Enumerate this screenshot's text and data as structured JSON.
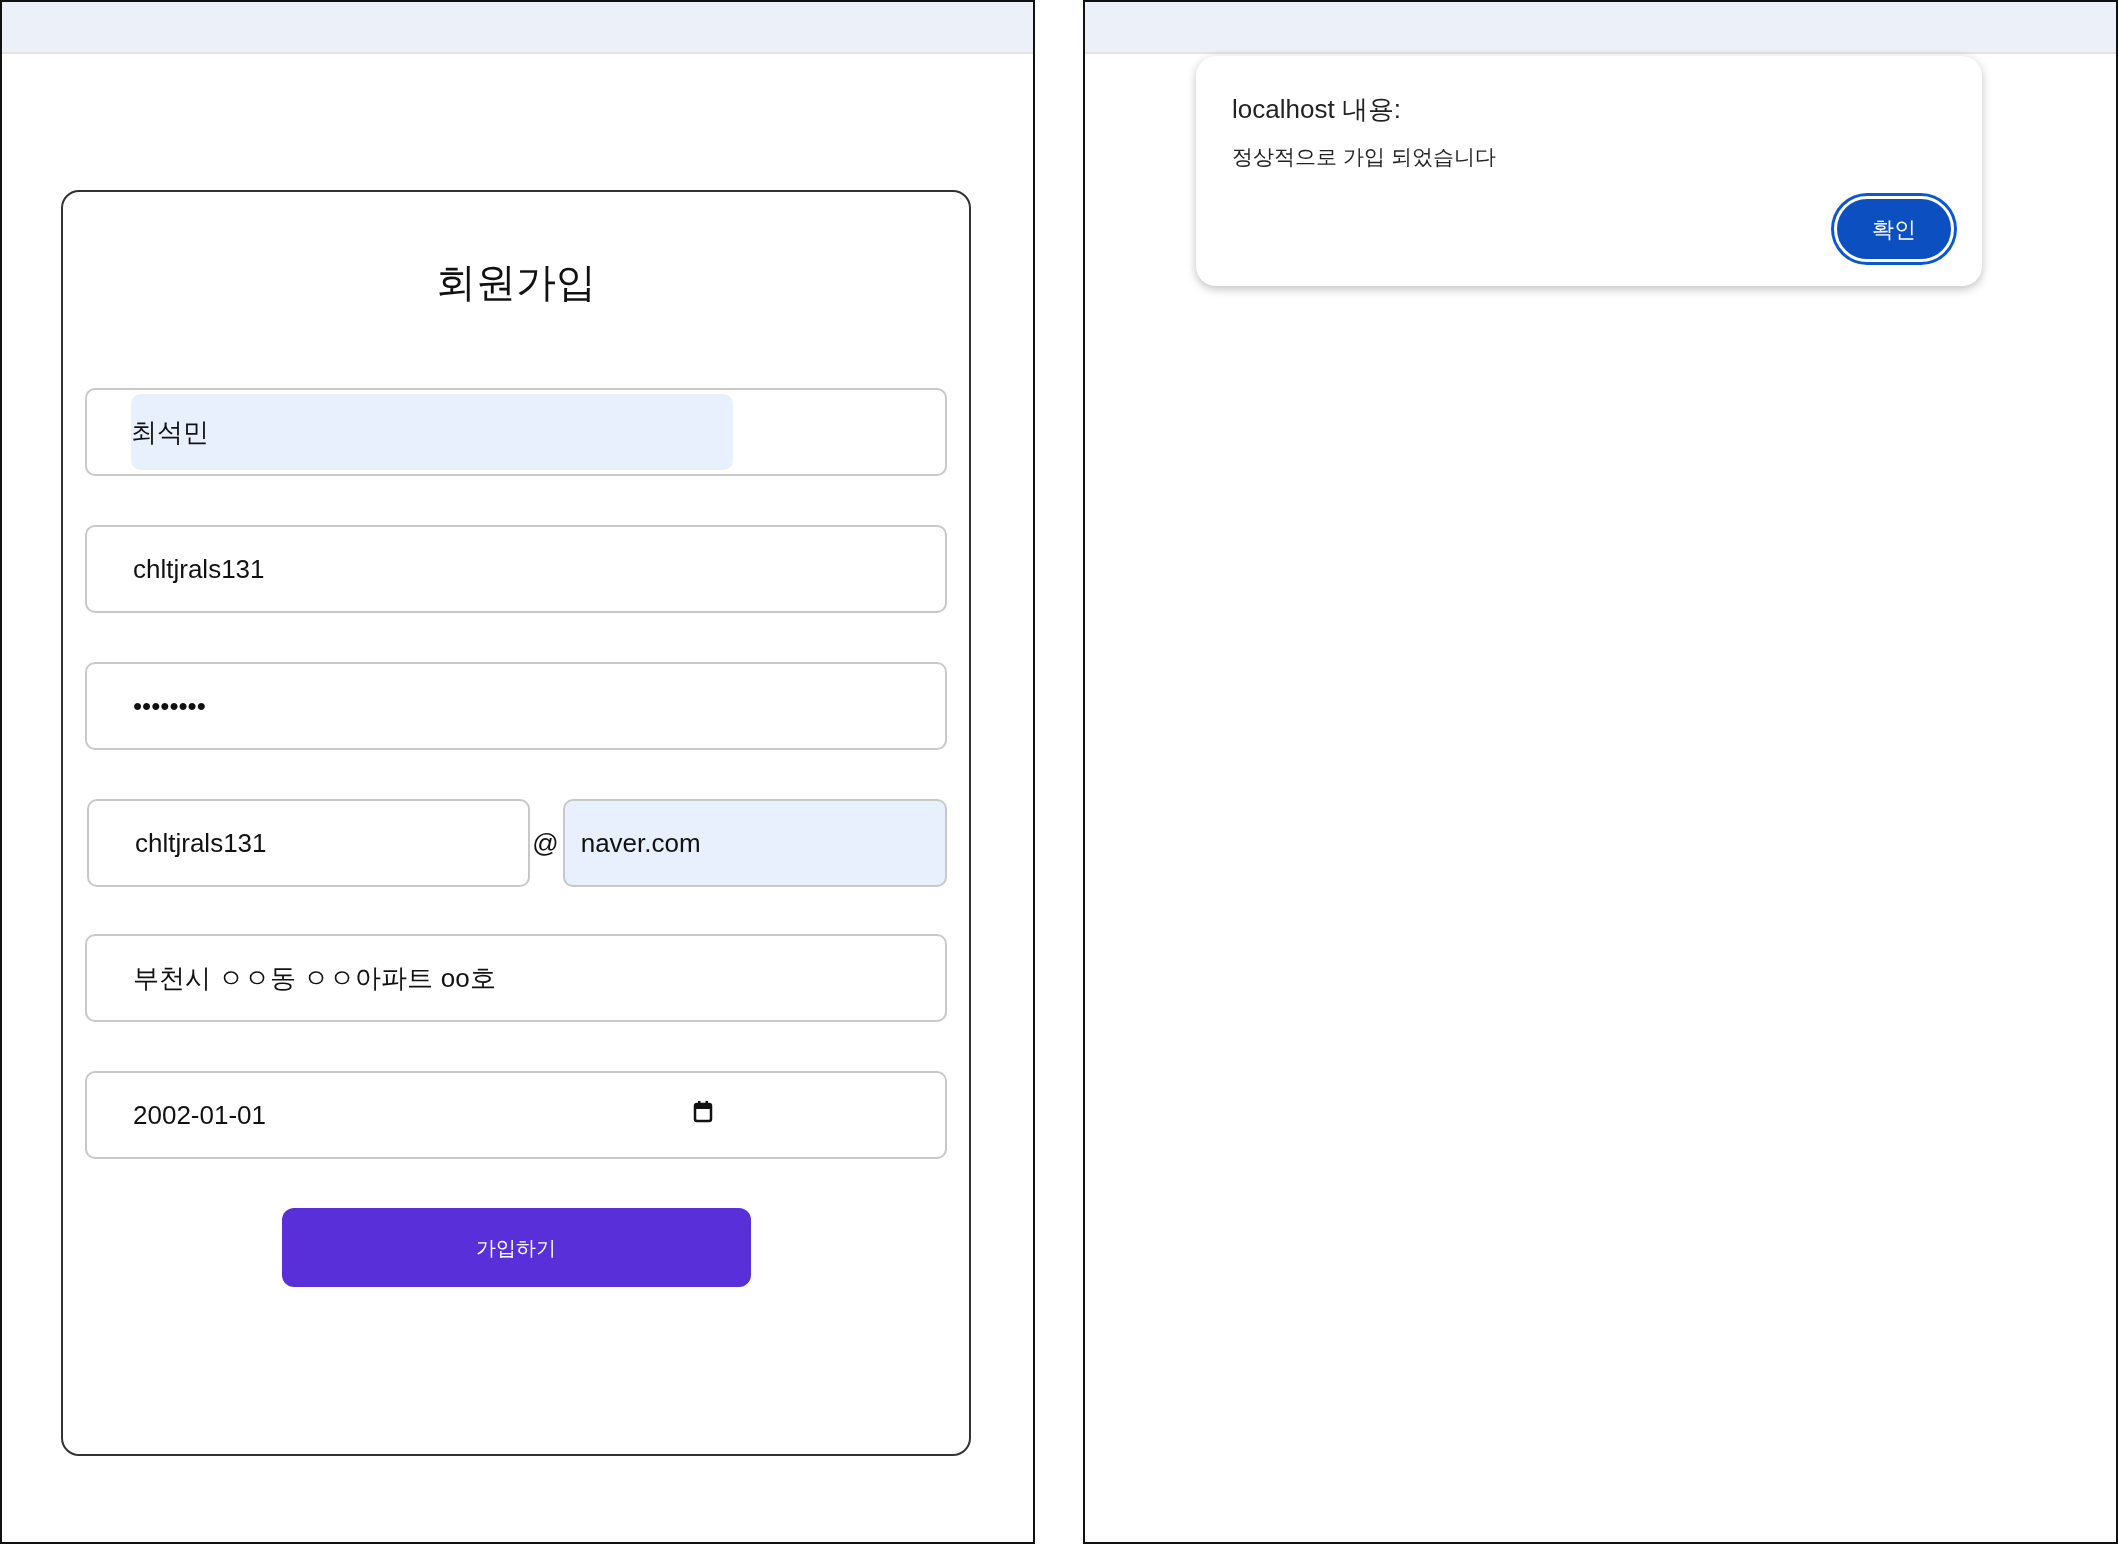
{
  "signup_page": {
    "title": "회원가입",
    "fields": [
      {
        "kind": "text",
        "value": "최석민",
        "autofilled": true
      },
      {
        "kind": "text",
        "value": "chltjrals131",
        "autofilled": false
      },
      {
        "kind": "password",
        "value": "••••••••",
        "autofilled": false
      },
      {
        "kind": "email",
        "local": "chltjrals131",
        "separator": "@",
        "domain": "naver.com",
        "local_autofilled": false,
        "domain_autofilled": true
      },
      {
        "kind": "text",
        "value": "부천시 ㅇㅇ동 ㅇㅇ아파트 oo호",
        "autofilled": false
      },
      {
        "kind": "date",
        "value": "2002-01-01",
        "autofilled": false
      }
    ],
    "submit_button": "가입하기"
  },
  "alert_dialog": {
    "title": "localhost 내용:",
    "message": "정상적으로 가입 되었습니다",
    "ok_button": "확인"
  }
}
